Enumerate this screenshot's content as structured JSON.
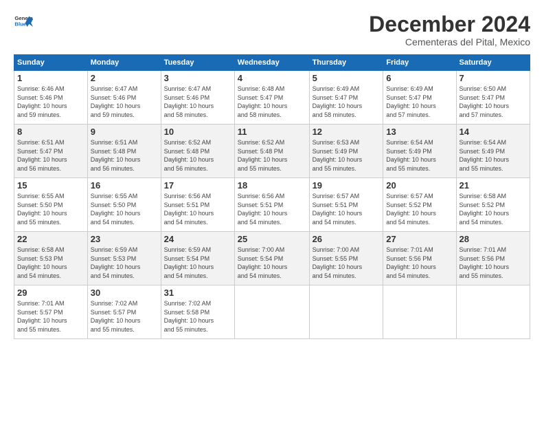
{
  "logo": {
    "line1": "General",
    "line2": "Blue"
  },
  "title": "December 2024",
  "subtitle": "Cementeras del Pital, Mexico",
  "days_of_week": [
    "Sunday",
    "Monday",
    "Tuesday",
    "Wednesday",
    "Thursday",
    "Friday",
    "Saturday"
  ],
  "weeks": [
    [
      {
        "day": "1",
        "sunrise": "6:46 AM",
        "sunset": "5:46 PM",
        "daylight": "10 hours and 59 minutes."
      },
      {
        "day": "2",
        "sunrise": "6:47 AM",
        "sunset": "5:46 PM",
        "daylight": "10 hours and 59 minutes."
      },
      {
        "day": "3",
        "sunrise": "6:47 AM",
        "sunset": "5:46 PM",
        "daylight": "10 hours and 58 minutes."
      },
      {
        "day": "4",
        "sunrise": "6:48 AM",
        "sunset": "5:47 PM",
        "daylight": "10 hours and 58 minutes."
      },
      {
        "day": "5",
        "sunrise": "6:49 AM",
        "sunset": "5:47 PM",
        "daylight": "10 hours and 58 minutes."
      },
      {
        "day": "6",
        "sunrise": "6:49 AM",
        "sunset": "5:47 PM",
        "daylight": "10 hours and 57 minutes."
      },
      {
        "day": "7",
        "sunrise": "6:50 AM",
        "sunset": "5:47 PM",
        "daylight": "10 hours and 57 minutes."
      }
    ],
    [
      {
        "day": "8",
        "sunrise": "6:51 AM",
        "sunset": "5:47 PM",
        "daylight": "10 hours and 56 minutes."
      },
      {
        "day": "9",
        "sunrise": "6:51 AM",
        "sunset": "5:48 PM",
        "daylight": "10 hours and 56 minutes."
      },
      {
        "day": "10",
        "sunrise": "6:52 AM",
        "sunset": "5:48 PM",
        "daylight": "10 hours and 56 minutes."
      },
      {
        "day": "11",
        "sunrise": "6:52 AM",
        "sunset": "5:48 PM",
        "daylight": "10 hours and 55 minutes."
      },
      {
        "day": "12",
        "sunrise": "6:53 AM",
        "sunset": "5:49 PM",
        "daylight": "10 hours and 55 minutes."
      },
      {
        "day": "13",
        "sunrise": "6:54 AM",
        "sunset": "5:49 PM",
        "daylight": "10 hours and 55 minutes."
      },
      {
        "day": "14",
        "sunrise": "6:54 AM",
        "sunset": "5:49 PM",
        "daylight": "10 hours and 55 minutes."
      }
    ],
    [
      {
        "day": "15",
        "sunrise": "6:55 AM",
        "sunset": "5:50 PM",
        "daylight": "10 hours and 55 minutes."
      },
      {
        "day": "16",
        "sunrise": "6:55 AM",
        "sunset": "5:50 PM",
        "daylight": "10 hours and 54 minutes."
      },
      {
        "day": "17",
        "sunrise": "6:56 AM",
        "sunset": "5:51 PM",
        "daylight": "10 hours and 54 minutes."
      },
      {
        "day": "18",
        "sunrise": "6:56 AM",
        "sunset": "5:51 PM",
        "daylight": "10 hours and 54 minutes."
      },
      {
        "day": "19",
        "sunrise": "6:57 AM",
        "sunset": "5:51 PM",
        "daylight": "10 hours and 54 minutes."
      },
      {
        "day": "20",
        "sunrise": "6:57 AM",
        "sunset": "5:52 PM",
        "daylight": "10 hours and 54 minutes."
      },
      {
        "day": "21",
        "sunrise": "6:58 AM",
        "sunset": "5:52 PM",
        "daylight": "10 hours and 54 minutes."
      }
    ],
    [
      {
        "day": "22",
        "sunrise": "6:58 AM",
        "sunset": "5:53 PM",
        "daylight": "10 hours and 54 minutes."
      },
      {
        "day": "23",
        "sunrise": "6:59 AM",
        "sunset": "5:53 PM",
        "daylight": "10 hours and 54 minutes."
      },
      {
        "day": "24",
        "sunrise": "6:59 AM",
        "sunset": "5:54 PM",
        "daylight": "10 hours and 54 minutes."
      },
      {
        "day": "25",
        "sunrise": "7:00 AM",
        "sunset": "5:54 PM",
        "daylight": "10 hours and 54 minutes."
      },
      {
        "day": "26",
        "sunrise": "7:00 AM",
        "sunset": "5:55 PM",
        "daylight": "10 hours and 54 minutes."
      },
      {
        "day": "27",
        "sunrise": "7:01 AM",
        "sunset": "5:56 PM",
        "daylight": "10 hours and 54 minutes."
      },
      {
        "day": "28",
        "sunrise": "7:01 AM",
        "sunset": "5:56 PM",
        "daylight": "10 hours and 55 minutes."
      }
    ],
    [
      {
        "day": "29",
        "sunrise": "7:01 AM",
        "sunset": "5:57 PM",
        "daylight": "10 hours and 55 minutes."
      },
      {
        "day": "30",
        "sunrise": "7:02 AM",
        "sunset": "5:57 PM",
        "daylight": "10 hours and 55 minutes."
      },
      {
        "day": "31",
        "sunrise": "7:02 AM",
        "sunset": "5:58 PM",
        "daylight": "10 hours and 55 minutes."
      },
      null,
      null,
      null,
      null
    ]
  ]
}
